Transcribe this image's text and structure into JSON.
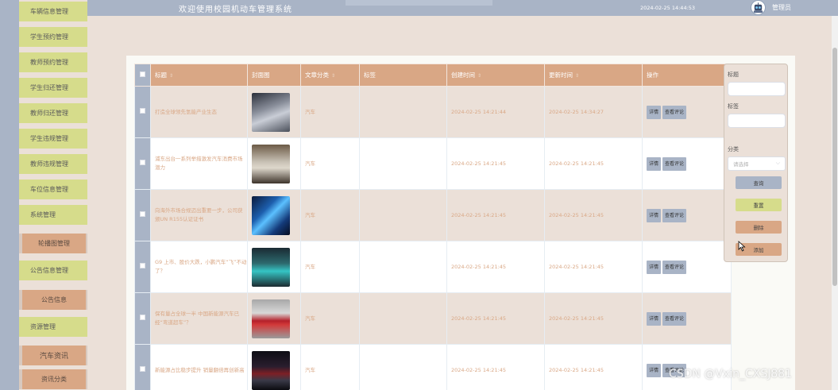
{
  "header": {
    "title": "欢迎使用校园机动车管理系统",
    "datetime": "2024-02-25 14:44:53",
    "role": "管理员",
    "avatar_icon": "robot-avatar-icon"
  },
  "sidebar": {
    "items": [
      {
        "label": "车辆信息管理",
        "type": "main"
      },
      {
        "label": "学生预约管理",
        "type": "main"
      },
      {
        "label": "教师预约管理",
        "type": "main"
      },
      {
        "label": "学生归还管理",
        "type": "main"
      },
      {
        "label": "教师归还管理",
        "type": "main"
      },
      {
        "label": "学生违规管理",
        "type": "main"
      },
      {
        "label": "教师违规管理",
        "type": "main"
      },
      {
        "label": "车位信息管理",
        "type": "main"
      },
      {
        "label": "系统管理",
        "type": "main"
      },
      {
        "label": "轮播图管理",
        "type": "sub"
      },
      {
        "label": "公告信息管理",
        "type": "main"
      },
      {
        "label": "公告信息",
        "type": "sub"
      },
      {
        "label": "资源管理",
        "type": "main"
      },
      {
        "label": "汽车资讯",
        "type": "sub"
      },
      {
        "label": "资讯分类",
        "type": "sub"
      }
    ]
  },
  "table": {
    "headers": {
      "title": "标题",
      "cover": "封面图",
      "category": "文章分类",
      "tags": "标签",
      "created": "创建时间",
      "updated": "更新时间",
      "actions": "操作"
    },
    "action_labels": {
      "detail": "详情",
      "comments": "查看评论"
    },
    "rows": [
      {
        "title": "打造全球领先氢能产业生态",
        "category": "汽车",
        "tags": "",
        "created": "2024-02-25 14:21:44",
        "updated": "2024-02-25 14:34:27"
      },
      {
        "title": "浦东出台一系列举措激发汽车消费市场潜力",
        "category": "汽车",
        "tags": "",
        "created": "2024-02-25 14:21:45",
        "updated": "2024-02-25 14:21:45"
      },
      {
        "title": "向海外市场合规迈出重要一步，公司获颁UN R155认证证书",
        "category": "汽车",
        "tags": "",
        "created": "2024-02-25 14:21:45",
        "updated": "2024-02-25 14:21:45"
      },
      {
        "title": "G9 上市、股价大跌，小鹏汽车“飞”不动了？",
        "category": "汽车",
        "tags": "",
        "created": "2024-02-25 14:21:45",
        "updated": "2024-02-25 14:21:45"
      },
      {
        "title": "保有量占全球一半 中国新能源汽车已经“弯道超车”？",
        "category": "汽车",
        "tags": "",
        "created": "2024-02-25 14:21:45",
        "updated": "2024-02-25 14:21:45"
      },
      {
        "title": "新能源占比稳步提升 销量翻倍再创新高",
        "category": "汽车",
        "tags": "",
        "created": "2024-02-25 14:21:45",
        "updated": "2024-02-25 14:21:45"
      }
    ]
  },
  "search_panel": {
    "title_label": "标题",
    "tags_label": "标签",
    "category_label": "分类",
    "category_placeholder": "请选择",
    "buttons": {
      "query": "查询",
      "reset": "重置",
      "delete": "删除",
      "add": "添加"
    }
  },
  "watermark": "CSDN @Vxin_CXSJ881",
  "colors": {
    "accent_peach": "#d9a785",
    "steel_blue": "#a9b4c6",
    "olive_yellow": "#d6dc8b",
    "beige_bg": "#ebe0d8"
  }
}
